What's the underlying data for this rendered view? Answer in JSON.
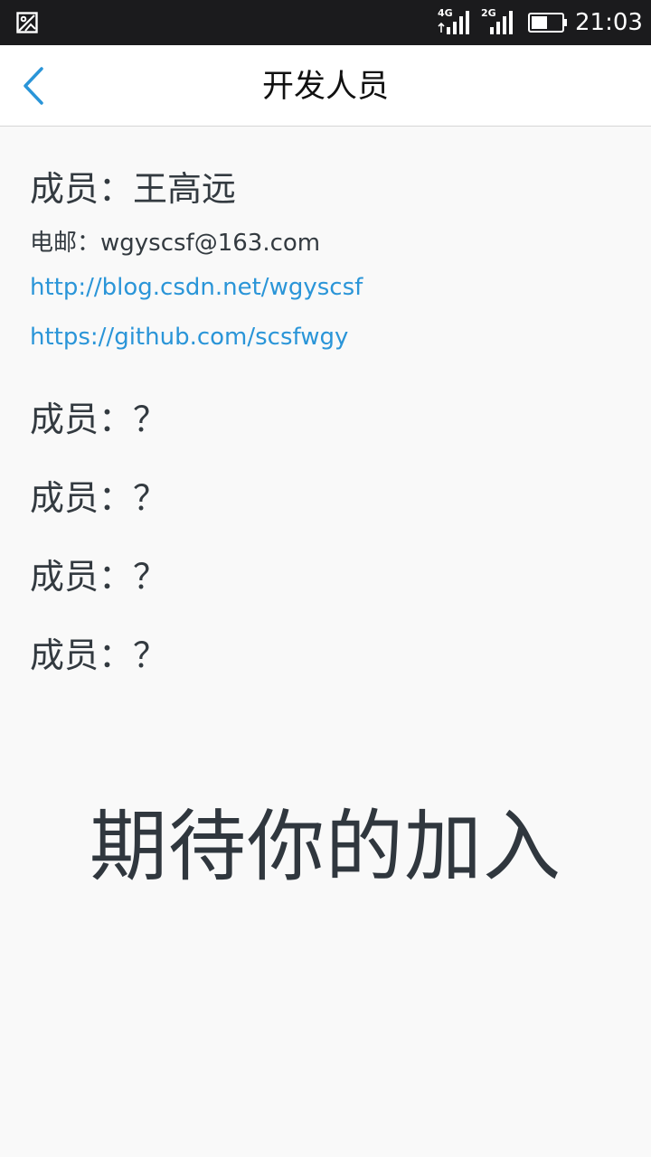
{
  "status_bar": {
    "network_1": "4G",
    "network_2": "2G",
    "time": "21:03",
    "icons": [
      "gallery-icon",
      "signal-icon",
      "signal-icon",
      "battery-icon"
    ]
  },
  "header": {
    "title": "开发人员",
    "back_icon": "chevron-left-icon"
  },
  "members": [
    {
      "name": "成员：王高远",
      "email": "电邮：wgyscsf@163.com",
      "links": [
        "http://blog.csdn.net/wgyscsf",
        "https://github.com/scsfwgy"
      ]
    },
    {
      "name": "成员：？"
    },
    {
      "name": "成员：？"
    },
    {
      "name": "成员：？"
    },
    {
      "name": "成员：？"
    }
  ],
  "join_message": "期待你的加入",
  "colors": {
    "status_bar_bg": "#1b1b1d",
    "header_bg": "#ffffff",
    "page_bg": "#f9f9f9",
    "text": "#333a40",
    "link": "#2a95d8",
    "accent": "#2a95d8"
  }
}
